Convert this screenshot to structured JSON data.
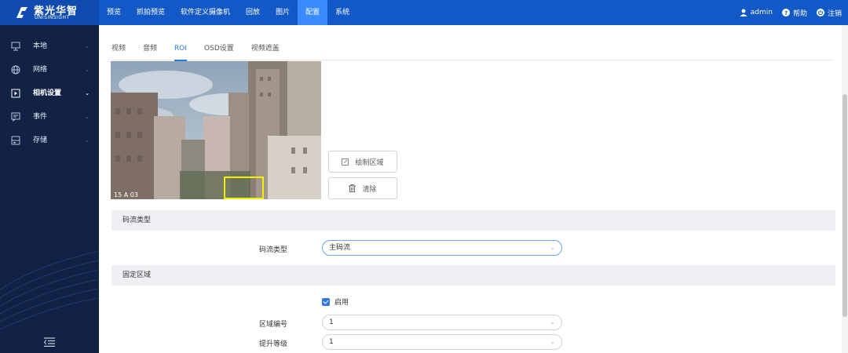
{
  "brand": {
    "name_cn": "紫光华智",
    "name_en": "UNISINSIGHT"
  },
  "topnav": {
    "items": [
      "预览",
      "抓拍预览",
      "软件定义摄像机",
      "回放",
      "图片",
      "配置",
      "系统"
    ],
    "active": "配置"
  },
  "user": {
    "name": "admin",
    "help": "帮助",
    "logout": "注销"
  },
  "sidebar": {
    "items": [
      "本地",
      "网络",
      "相机设置",
      "事件",
      "存储"
    ],
    "active": "相机设置"
  },
  "tabs": {
    "items": [
      "视频",
      "音频",
      "ROI",
      "OSD设置",
      "视频遮盖"
    ],
    "active": "ROI"
  },
  "video": {
    "timestamp": "15 A 03"
  },
  "buttons": {
    "draw": "绘制区域",
    "clear": "清除"
  },
  "stream_section": {
    "title": "码流类型",
    "label": "码流类型",
    "value": "主码流"
  },
  "fixed_section": {
    "title": "固定区域",
    "enable_label": "启用",
    "enabled": true,
    "region_label": "区域编号",
    "region_value": "1",
    "level_label": "提升等级",
    "level_value": "1"
  },
  "colors": {
    "topbar": "#1358c7",
    "active_nav": "#3a8bff",
    "sidebar": "#112244",
    "accent": "#2e7bd9",
    "roi_box": "#f5f000"
  }
}
